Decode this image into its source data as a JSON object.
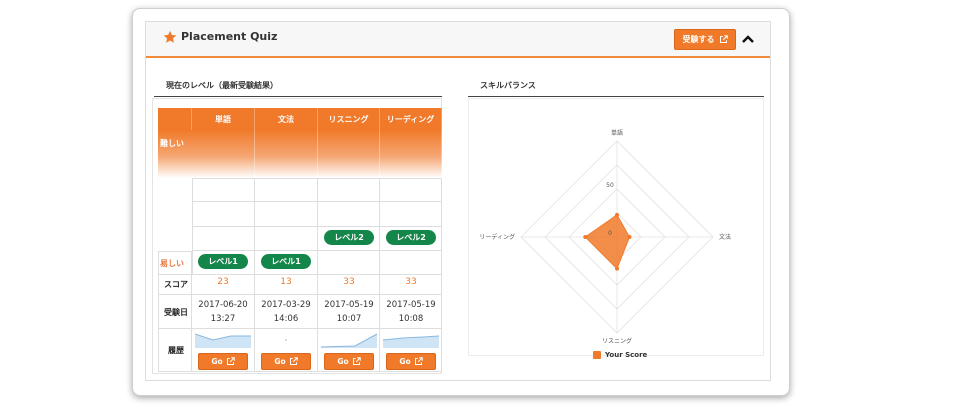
{
  "header": {
    "title": "Placement Quiz",
    "take_button": "受験する"
  },
  "level_section": {
    "title": "現在のレベル（最新受験結果）",
    "columns": [
      "単語",
      "文法",
      "リスニング",
      "リーディング"
    ],
    "hard_label": "難しい",
    "easy_label": "易しい",
    "score_label": "スコア",
    "date_label": "受験日",
    "history_label": "履歴",
    "levels": [
      "レベル1",
      "レベル1",
      "レベル2",
      "レベル2"
    ],
    "scores": [
      "23",
      "13",
      "33",
      "33"
    ],
    "dates": [
      "2017-06-20",
      "2017-03-29",
      "2017-05-19",
      "2017-05-19"
    ],
    "times": [
      "13:27",
      "14:06",
      "10:07",
      "10:08"
    ],
    "go_label": "Go"
  },
  "skill_section": {
    "title": "スキルバランス",
    "axes": [
      "単語",
      "文法",
      "リスニング",
      "リーディング"
    ],
    "ticks": [
      "0",
      "50"
    ],
    "legend": "Your Score"
  },
  "chart_data": {
    "type": "radar",
    "categories": [
      "単語",
      "文法",
      "リスニング",
      "リーディング"
    ],
    "series": [
      {
        "name": "Your Score",
        "values": [
          23,
          13,
          33,
          33
        ]
      }
    ],
    "ticks": [
      0,
      50
    ],
    "range": [
      0,
      100
    ],
    "grid": true,
    "legend_position": "bottom"
  },
  "colors": {
    "accent": "#f07a2a",
    "level_green": "#14864a",
    "spark_fill": "#cfe4f5",
    "spark_line": "#8ab8df"
  }
}
